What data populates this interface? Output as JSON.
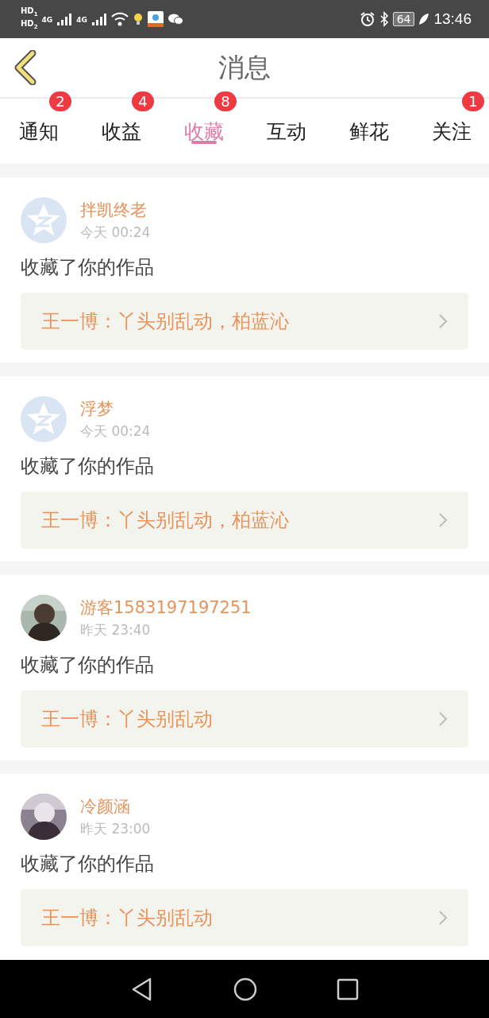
{
  "status_bar": {
    "sims": [
      {
        "label": "HD",
        "slot": "1"
      },
      {
        "label": "HD",
        "slot": "2"
      }
    ],
    "networks": [
      "4G",
      "4G"
    ],
    "battery": "64",
    "time": "13:46"
  },
  "header": {
    "title": "消息"
  },
  "tabs": [
    {
      "label": "通知",
      "badge": "2",
      "selected": false
    },
    {
      "label": "收益",
      "badge": "4",
      "selected": false
    },
    {
      "label": "收藏",
      "badge": "8",
      "selected": true
    },
    {
      "label": "互动",
      "selected": false
    },
    {
      "label": "鲜花",
      "selected": false
    },
    {
      "label": "关注",
      "badge": "1",
      "selected": false
    }
  ],
  "messages": [
    {
      "avatar": {
        "kind": "default"
      },
      "name": "拌凯终老",
      "time": "今天 00:24",
      "action": "收藏了你的作品",
      "work": "王一博：丫头别乱动，柏蓝沁"
    },
    {
      "avatar": {
        "kind": "default"
      },
      "name": "浮梦",
      "time": "今天 00:24",
      "action": "收藏了你的作品",
      "work": "王一博：丫头别乱动，柏蓝沁"
    },
    {
      "name": "游客1583197197251",
      "time": "昨天 23:40",
      "action": "收藏了你的作品",
      "work": "王一博：丫头别乱动"
    },
    {
      "name": "冷颜涵",
      "time": "昨天 23:00",
      "action": "收藏了你的作品",
      "work": "王一博：丫头别乱动"
    }
  ]
}
